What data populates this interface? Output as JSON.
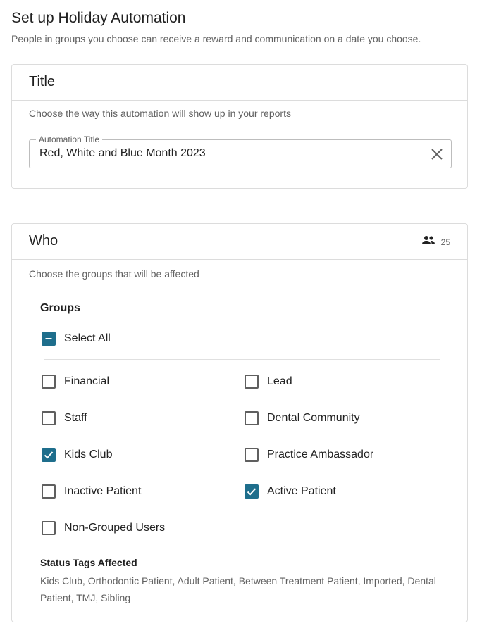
{
  "page": {
    "title": "Set up Holiday Automation",
    "subtitle": "People in groups you choose can receive a reward and communication on a date you choose."
  },
  "title_card": {
    "heading": "Title",
    "description": "Choose the way this automation will show up in your reports",
    "field": {
      "label": "Automation Title",
      "value": "Red, White and Blue Month 2023"
    }
  },
  "who_card": {
    "heading": "Who",
    "user_count": "25",
    "description": "Choose the groups that will be affected",
    "groups_label": "Groups",
    "select_all": {
      "label": "Select All",
      "state": "indeterminate"
    },
    "groups": [
      {
        "label": "Financial",
        "checked": false
      },
      {
        "label": "Lead",
        "checked": false
      },
      {
        "label": "Staff",
        "checked": false
      },
      {
        "label": "Dental Community",
        "checked": false
      },
      {
        "label": "Kids Club",
        "checked": true
      },
      {
        "label": "Practice Ambassador",
        "checked": false
      },
      {
        "label": "Inactive Patient",
        "checked": false
      },
      {
        "label": "Active Patient",
        "checked": true
      },
      {
        "label": "Non-Grouped Users",
        "checked": false
      }
    ],
    "status_tags_label": "Status Tags Affected",
    "status_tags": "Kids Club, Orthodontic Patient, Adult Patient, Between Treatment Patient, Imported, Dental Patient, TMJ, Sibling"
  },
  "colors": {
    "accent": "#1e6e8c",
    "border": "#dcdcdc",
    "text_secondary": "#616161"
  },
  "icons": {
    "clear": "close-icon",
    "users": "people-icon"
  }
}
